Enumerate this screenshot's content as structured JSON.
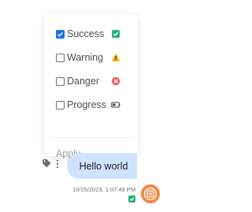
{
  "filter": {
    "options": [
      {
        "label": "Success",
        "checked": true,
        "icon": "success-check-icon",
        "color": "#27b07a"
      },
      {
        "label": "Warning",
        "checked": false,
        "icon": "warning-triangle-icon",
        "color": "#f5b400"
      },
      {
        "label": "Danger",
        "checked": false,
        "icon": "danger-x-icon",
        "color": "#f05a6a"
      },
      {
        "label": "Progress",
        "checked": false,
        "icon": "progress-battery-icon",
        "color": "#3c4043"
      }
    ],
    "apply_label": "Apply"
  },
  "message": {
    "text": "Hello world",
    "timestamp": "10/25/2023, 1:07:49 PM",
    "status": "success",
    "bubble_color": "#cfe3ff"
  },
  "avatar": {
    "icon": "bot-avatar-icon",
    "color": "#f4863a"
  },
  "colors": {
    "accent": "#1a73e8"
  }
}
